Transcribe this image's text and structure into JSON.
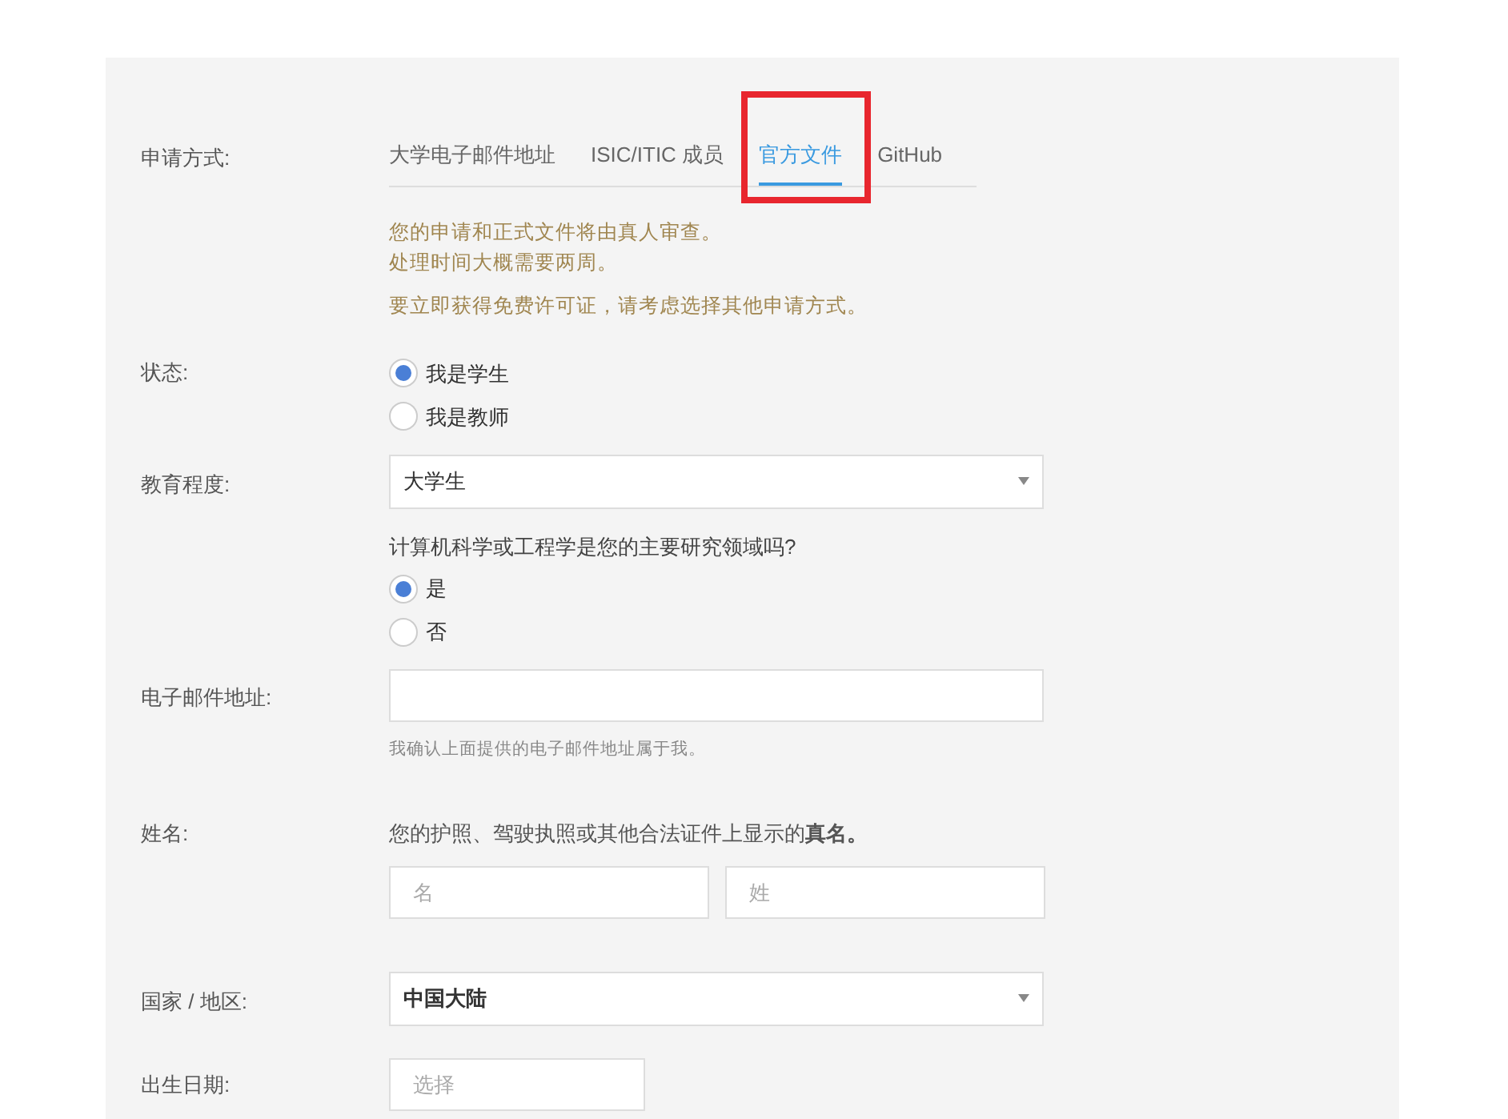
{
  "method": {
    "label": "申请方式:",
    "tabs": [
      {
        "label": "大学电子邮件地址",
        "selected": false
      },
      {
        "label": "ISIC/ITIC 成员",
        "selected": false
      },
      {
        "label": "官方文件",
        "selected": true
      },
      {
        "label": "GitHub",
        "selected": false
      }
    ]
  },
  "notice": {
    "lines": [
      "您的申请和正式文件将由真人审查。",
      "处理时间大概需要两周。"
    ],
    "extra": "要立即获得免费许可证，请考虑选择其他申请方式。"
  },
  "status": {
    "label": "状态:",
    "options": [
      {
        "label": "我是学生",
        "selected": true
      },
      {
        "label": "我是教师",
        "selected": false
      }
    ]
  },
  "education": {
    "label": "教育程度:",
    "value": "大学生",
    "question": "计算机科学或工程学是您的主要研究领域吗?",
    "options": [
      {
        "label": "是",
        "selected": true
      },
      {
        "label": "否",
        "selected": false
      }
    ]
  },
  "email": {
    "label": "电子邮件地址:",
    "hint": "我确认上面提供的电子邮件地址属于我。"
  },
  "name": {
    "label": "姓名:",
    "note": "您的护照、驾驶执照或其他合法证件上显示的**真名。**",
    "first_placeholder": "名",
    "last_placeholder": "姓"
  },
  "country": {
    "label": "国家 / 地区:",
    "value": "中国大陆"
  },
  "birth": {
    "label": "出生日期:",
    "placeholder": "选择"
  }
}
